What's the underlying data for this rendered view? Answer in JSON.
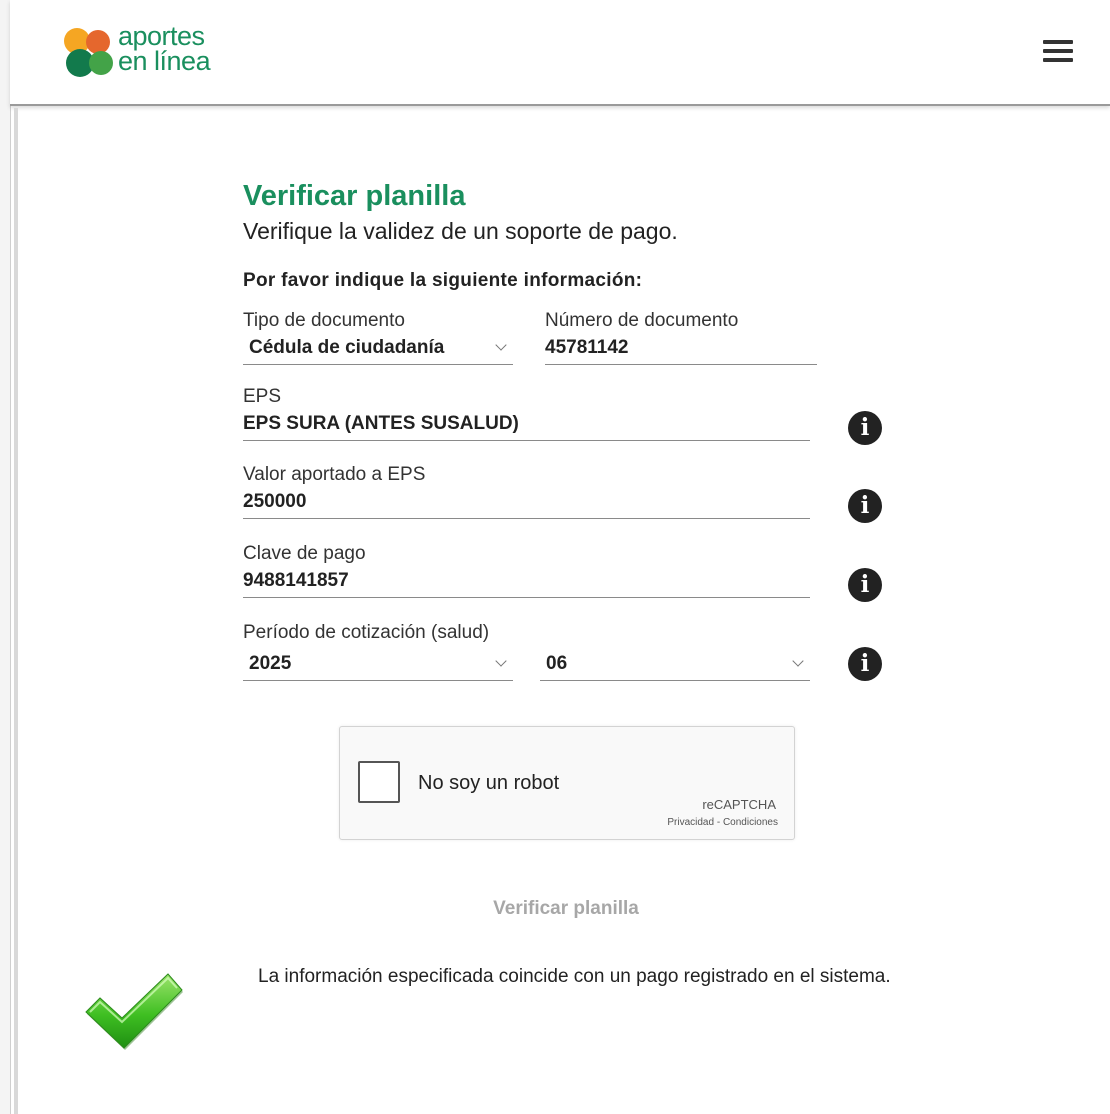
{
  "app": {
    "logo_line1": "aportes",
    "logo_line2": "en línea",
    "menu_icon": "hamburger-menu-icon",
    "brand_color": "#1a8f5e"
  },
  "page": {
    "title": "Verificar planilla",
    "subtitle": "Verifique la validez de un soporte de pago.",
    "instructions": "Por favor indique la siguiente información:"
  },
  "form": {
    "doc_type": {
      "label": "Tipo de documento",
      "value": "Cédula de ciudadanía"
    },
    "doc_number": {
      "label": "Número de documento",
      "value": "45781142"
    },
    "eps": {
      "label": "EPS",
      "value": "EPS SURA (ANTES SUSALUD)"
    },
    "eps_value": {
      "label": "Valor aportado a EPS",
      "value": "250000"
    },
    "payment_key": {
      "label": "Clave de pago",
      "value": "9488141857"
    },
    "period": {
      "label": "Período de cotización (salud)",
      "year": "2025",
      "month": "06"
    }
  },
  "captcha": {
    "label": "No soy un robot",
    "brand": "reCAPTCHA",
    "privacy": "Privacidad",
    "separator": " - ",
    "terms": "Condiciones"
  },
  "actions": {
    "verify_label": "Verificar planilla"
  },
  "result": {
    "message": "La información especificada coincide con un pago registrado en el sistema.",
    "icon": "green-checkmark-icon"
  },
  "icons": {
    "info": "i"
  }
}
